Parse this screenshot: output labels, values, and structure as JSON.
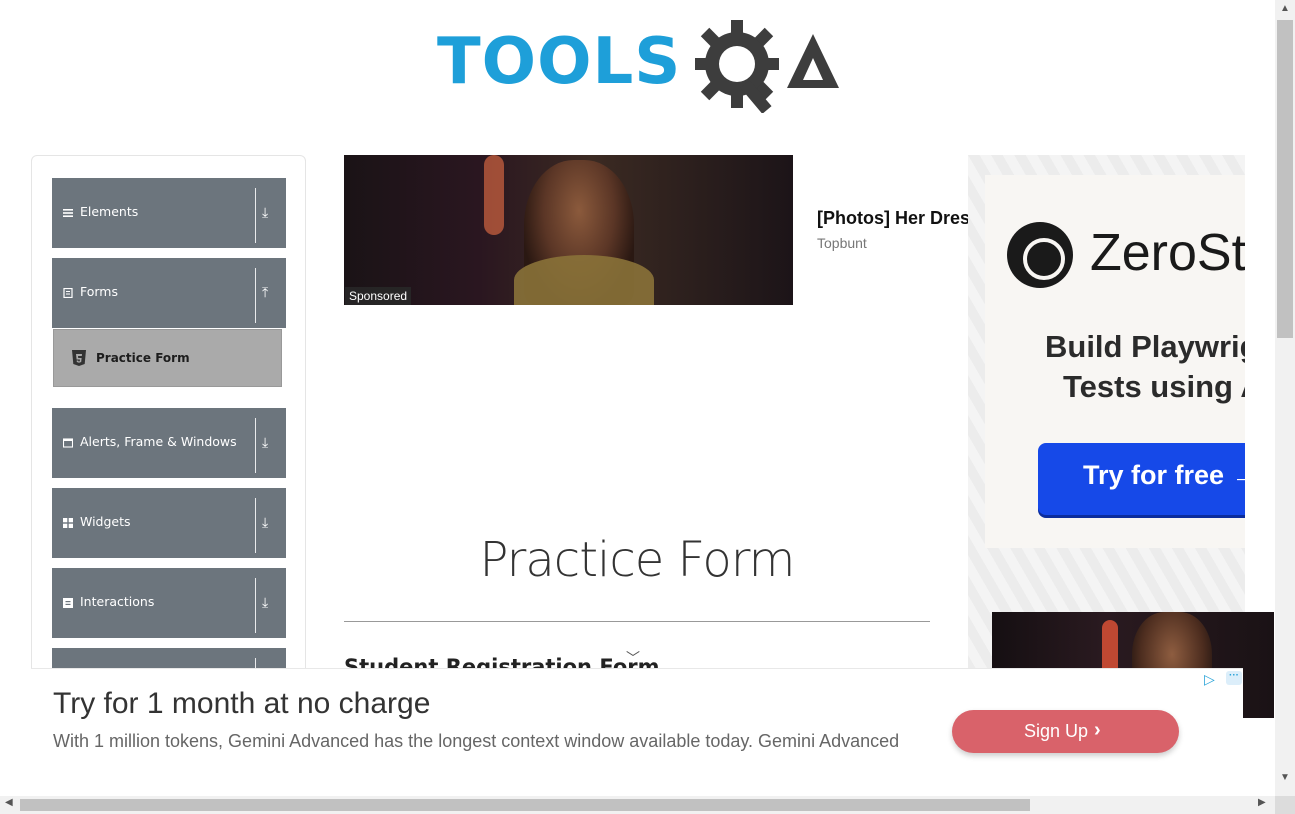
{
  "header": {
    "logo_text": "TOOLS",
    "logo_suffix": "QA",
    "logo_icon": "gear-magnifier-icon"
  },
  "sidebar": {
    "groups": [
      {
        "label": "Elements",
        "icon": "list-icon",
        "arrow": "⤓"
      },
      {
        "label": "Forms",
        "icon": "form-icon",
        "arrow": "⤒"
      },
      {
        "label": "Alerts, Frame & Windows",
        "icon": "window-icon",
        "arrow": "⤓"
      },
      {
        "label": "Widgets",
        "icon": "widgets-icon",
        "arrow": "⤓"
      },
      {
        "label": "Interactions",
        "icon": "interactions-icon",
        "arrow": "⤓"
      }
    ],
    "subitem": {
      "label": "Practice Form",
      "icon": "html5-shield-icon"
    }
  },
  "sponsored_ad": {
    "badge": "Sponsored",
    "title": "[Photos] Her Dress",
    "source": "Topbunt"
  },
  "main": {
    "title": "Practice Form",
    "subtitle": "Student Registration Form"
  },
  "right_ad": {
    "brand": "ZeroStep",
    "headline_line1": "Build Playwright",
    "headline_line2": "Tests using AI",
    "button": "Try for free →"
  },
  "bottom_ad": {
    "headline": "Try for 1 month at no charge",
    "body": "With 1 million tokens, Gemini Advanced has the longest context window available today. Gemini Advanced",
    "button": "Sign Up",
    "button_chevron": "›",
    "adchoices": "▷",
    "more": "···"
  },
  "colors": {
    "logo_blue": "#1e9fd9",
    "logo_dark": "#3d3d3d",
    "nav_bg": "#6c757d",
    "nav_active_bg": "#aaaaaa",
    "cta_blue": "#1649e8",
    "signup_red": "#d9626a"
  }
}
